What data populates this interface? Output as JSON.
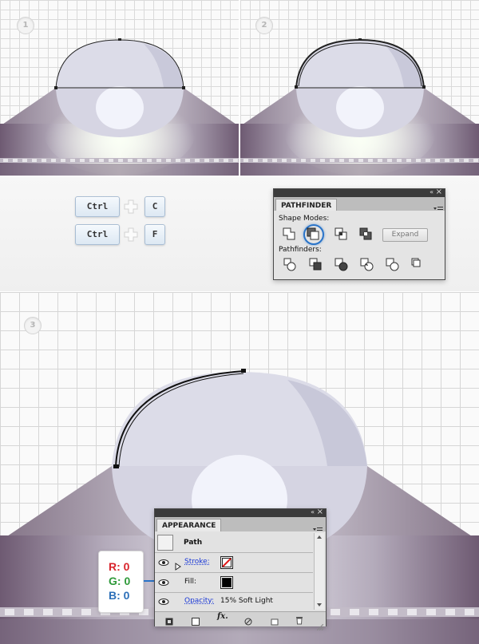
{
  "steps": {
    "step1": "1",
    "step2": "2",
    "step3": "3"
  },
  "shortcuts": {
    "copy": {
      "mod": "Ctrl",
      "key": "C"
    },
    "paste_front": {
      "mod": "Ctrl",
      "key": "F"
    }
  },
  "pathfinder": {
    "tab": "PATHFINDER",
    "shape_modes_label": "Shape Modes:",
    "pathfinders_label": "Pathfinders:",
    "expand_label": "Expand",
    "collapse_icon": "«",
    "close_icon": "×"
  },
  "appearance": {
    "tab": "APPEARANCE",
    "object": "Path",
    "stroke_label": "Stroke:",
    "fill_label": "Fill:",
    "opacity_label": "Opacity:",
    "opacity_value": "15% Soft Light",
    "collapse_icon": "«",
    "close_icon": "×",
    "fx_label": "fx."
  },
  "color_values": {
    "r": "R: 0",
    "g": "G: 0",
    "b": "B: 0"
  },
  "colors": {
    "accent_blue": "#2a74c9",
    "red": "#d9242c",
    "green": "#2f9a3a",
    "blue": "#2c6fb8",
    "ufo_purple": "#6d5b73"
  }
}
